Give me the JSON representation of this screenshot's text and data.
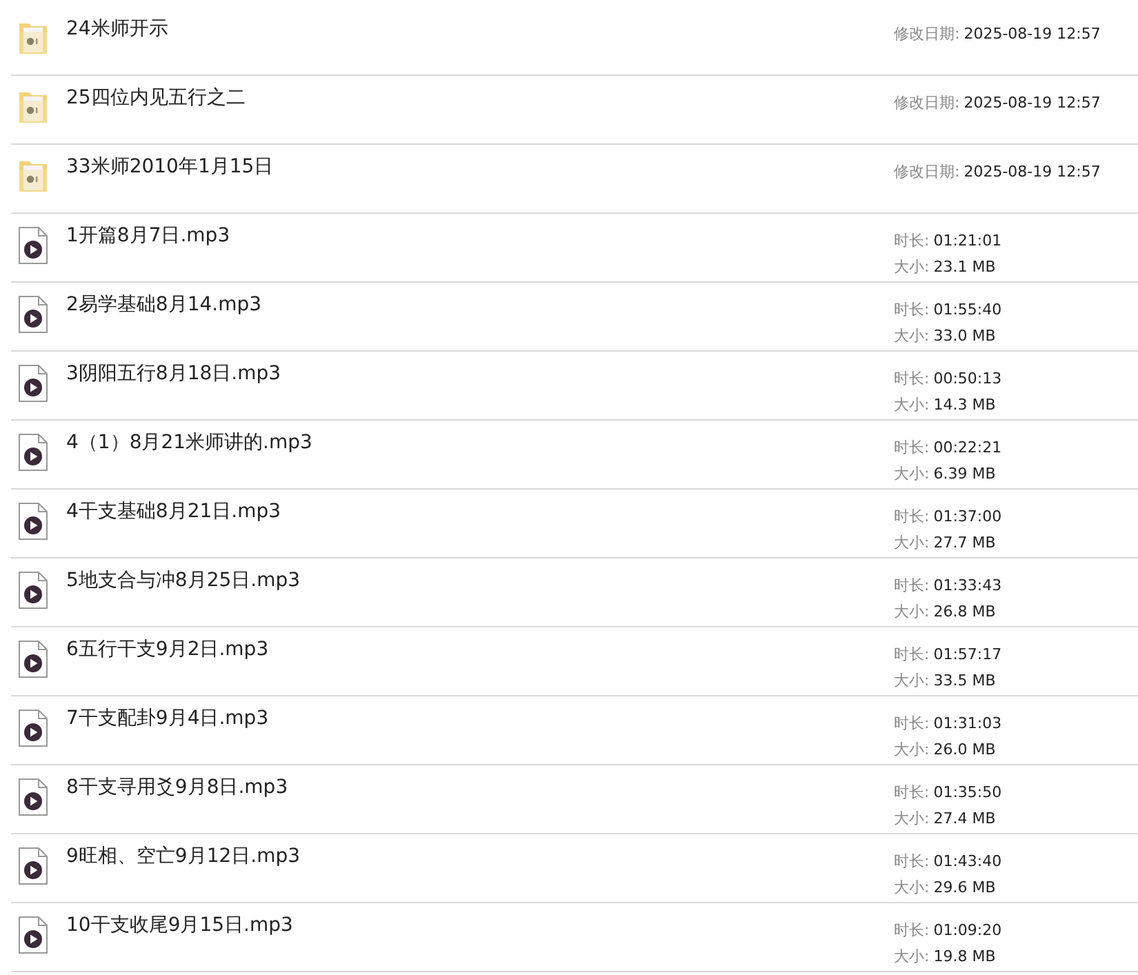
{
  "files": [
    {
      "kind": "folder",
      "name": "24米师开示",
      "details": [
        {
          "label": "修改日期:",
          "value": "2025-08-19 12:57"
        }
      ]
    },
    {
      "kind": "folder",
      "name": "25四位内见五行之二",
      "details": [
        {
          "label": "修改日期:",
          "value": "2025-08-19 12:57"
        }
      ]
    },
    {
      "kind": "folder",
      "name": "33米师2010年1月15日",
      "details": [
        {
          "label": "修改日期:",
          "value": "2025-08-19 12:57"
        }
      ]
    },
    {
      "kind": "audio",
      "name": "1开篇8月7日.mp3",
      "details": [
        {
          "label": "时长:",
          "value": "01:21:01"
        },
        {
          "label": "大小:",
          "value": "23.1 MB"
        }
      ]
    },
    {
      "kind": "audio",
      "name": "2易学基础8月14.mp3",
      "details": [
        {
          "label": "时长:",
          "value": "01:55:40"
        },
        {
          "label": "大小:",
          "value": "33.0 MB"
        }
      ]
    },
    {
      "kind": "audio",
      "name": "3阴阳五行8月18日.mp3",
      "details": [
        {
          "label": "时长:",
          "value": "00:50:13"
        },
        {
          "label": "大小:",
          "value": "14.3 MB"
        }
      ]
    },
    {
      "kind": "audio",
      "name": "4（1）8月21米师讲的.mp3",
      "details": [
        {
          "label": "时长:",
          "value": "00:22:21"
        },
        {
          "label": "大小:",
          "value": "6.39 MB"
        }
      ]
    },
    {
      "kind": "audio",
      "name": "4干支基础8月21日.mp3",
      "details": [
        {
          "label": "时长:",
          "value": "01:37:00"
        },
        {
          "label": "大小:",
          "value": "27.7 MB"
        }
      ]
    },
    {
      "kind": "audio",
      "name": "5地支合与冲8月25日.mp3",
      "details": [
        {
          "label": "时长:",
          "value": "01:33:43"
        },
        {
          "label": "大小:",
          "value": "26.8 MB"
        }
      ]
    },
    {
      "kind": "audio",
      "name": "6五行干支9月2日.mp3",
      "details": [
        {
          "label": "时长:",
          "value": "01:57:17"
        },
        {
          "label": "大小:",
          "value": "33.5 MB"
        }
      ]
    },
    {
      "kind": "audio",
      "name": "7干支配卦9月4日.mp3",
      "details": [
        {
          "label": "时长:",
          "value": "01:31:03"
        },
        {
          "label": "大小:",
          "value": "26.0 MB"
        }
      ]
    },
    {
      "kind": "audio",
      "name": "8干支寻用爻9月8日.mp3",
      "details": [
        {
          "label": "时长:",
          "value": "01:35:50"
        },
        {
          "label": "大小:",
          "value": "27.4 MB"
        }
      ]
    },
    {
      "kind": "audio",
      "name": "9旺相、空亡9月12日.mp3",
      "details": [
        {
          "label": "时长:",
          "value": "01:43:40"
        },
        {
          "label": "大小:",
          "value": "29.6 MB"
        }
      ]
    },
    {
      "kind": "audio",
      "name": "10干支收尾9月15日.mp3",
      "details": [
        {
          "label": "时长:",
          "value": "01:09:20"
        },
        {
          "label": "大小:",
          "value": "19.8 MB"
        }
      ]
    }
  ]
}
